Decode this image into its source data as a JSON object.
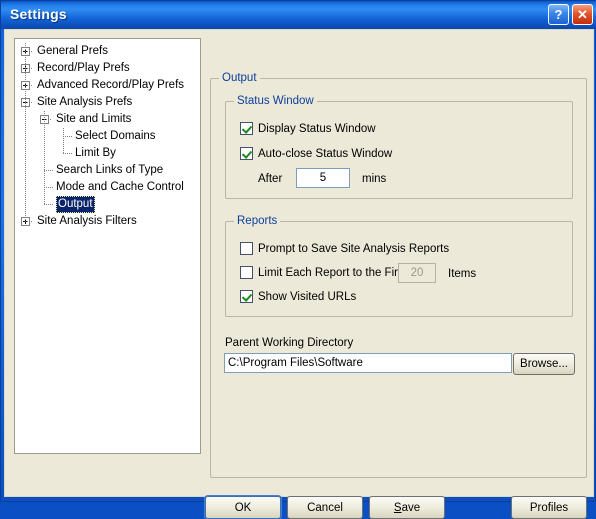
{
  "window": {
    "title": "Settings",
    "help_button": "?",
    "close_button": "✕",
    "accent_blue": "#0a55c8",
    "label_blue": "#0b3f9c",
    "face": "#ece9d8",
    "selection_blue": "#0a246a",
    "check_green": "#1a8a1a"
  },
  "tree": {
    "nodes": [
      {
        "label": "General Prefs",
        "depth": 0,
        "expander": "plus",
        "selected": false
      },
      {
        "label": "Record/Play Prefs",
        "depth": 0,
        "expander": "plus",
        "selected": false
      },
      {
        "label": "Advanced Record/Play Prefs",
        "depth": 0,
        "expander": "plus",
        "selected": false
      },
      {
        "label": "Site Analysis Prefs",
        "depth": 0,
        "expander": "minus",
        "selected": false
      },
      {
        "label": "Site and Limits",
        "depth": 1,
        "expander": "minus",
        "selected": false
      },
      {
        "label": "Select Domains",
        "depth": 2,
        "expander": "none",
        "selected": false
      },
      {
        "label": "Limit By",
        "depth": 2,
        "expander": "none",
        "selected": false
      },
      {
        "label": "Search Links of Type",
        "depth": 1,
        "expander": "none",
        "selected": false
      },
      {
        "label": "Mode and Cache Control",
        "depth": 1,
        "expander": "none",
        "selected": false
      },
      {
        "label": "Output",
        "depth": 1,
        "expander": "none",
        "selected": true
      },
      {
        "label": "Site Analysis Filters",
        "depth": 0,
        "expander": "plus",
        "selected": false
      }
    ]
  },
  "output_pane": {
    "group_title": "Output",
    "status_window": {
      "group_title": "Status Window",
      "display_status_window": {
        "label": "Display Status Window",
        "checked": true
      },
      "auto_close_status_window": {
        "label": "Auto-close Status Window",
        "checked": true
      },
      "after_label": "After",
      "after_value": "5",
      "mins_label": "mins"
    },
    "reports": {
      "group_title": "Reports",
      "prompt_to_save": {
        "label": "Prompt to Save Site Analysis Reports",
        "checked": false
      },
      "limit_each_report": {
        "label": "Limit Each Report to the First",
        "checked": false
      },
      "limit_value": "20",
      "items_label": "Items",
      "show_visited_urls": {
        "label": "Show Visited URLs",
        "checked": true
      }
    },
    "parent_working_directory": {
      "label": "Parent Working Directory",
      "value": "C:\\Program Files\\Software Research\\eValid\\Program\\Docs'",
      "browse_button": "Browse..."
    }
  },
  "buttons": {
    "ok": "OK",
    "cancel": "Cancel",
    "save_prefix": "S",
    "save_suffix": "ave",
    "profiles": "Profiles"
  }
}
